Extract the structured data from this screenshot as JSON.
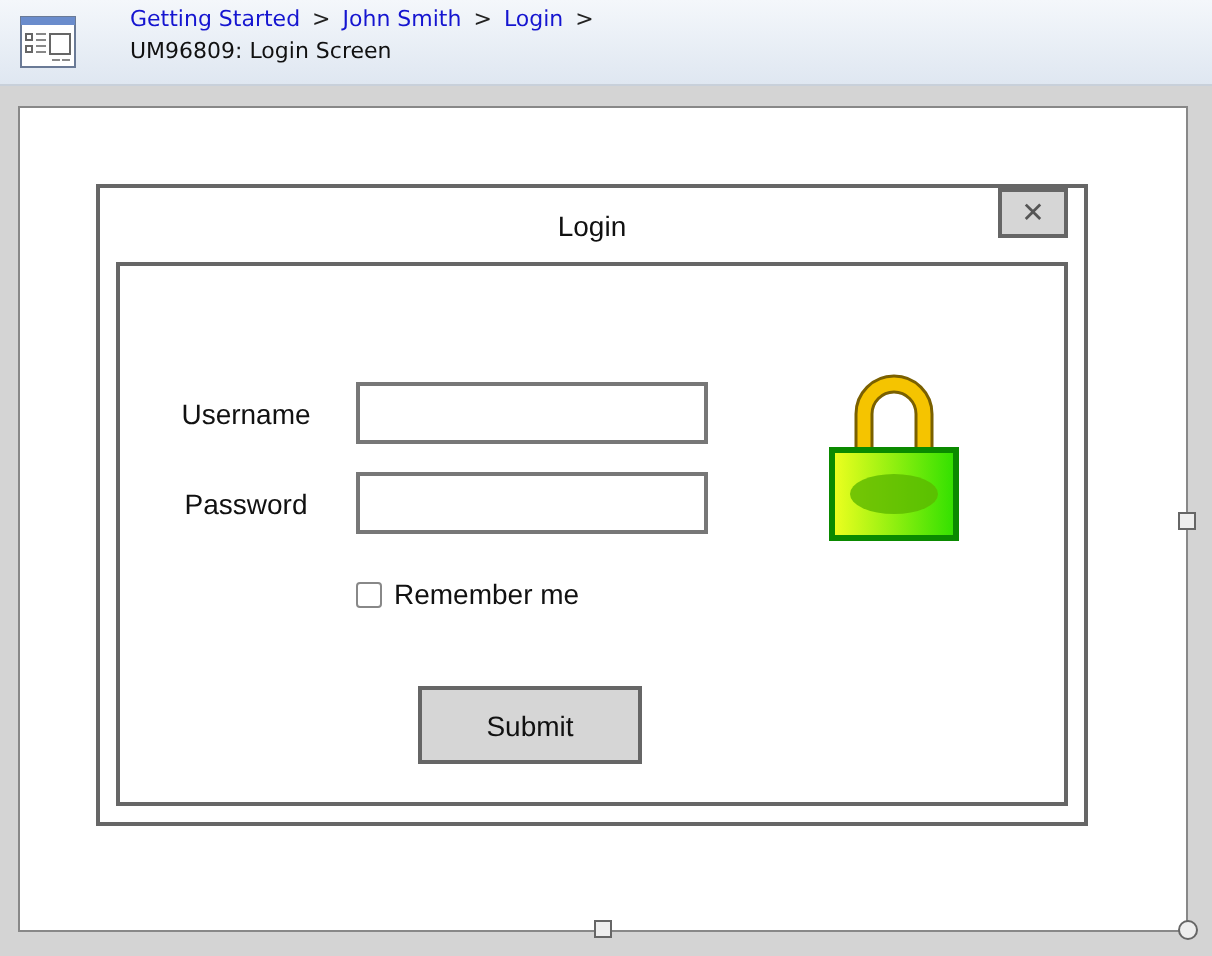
{
  "breadcrumb": [
    "Getting Started",
    "John Smith",
    "Login"
  ],
  "separator": ">",
  "page_title": "UM96809: Login Screen",
  "dialog": {
    "title": "Login",
    "close": "✕",
    "fields": [
      {
        "label": "Username"
      },
      {
        "label": "Password"
      }
    ],
    "remember": {
      "label": "Remember me",
      "checked": false
    },
    "submit": "Submit"
  }
}
